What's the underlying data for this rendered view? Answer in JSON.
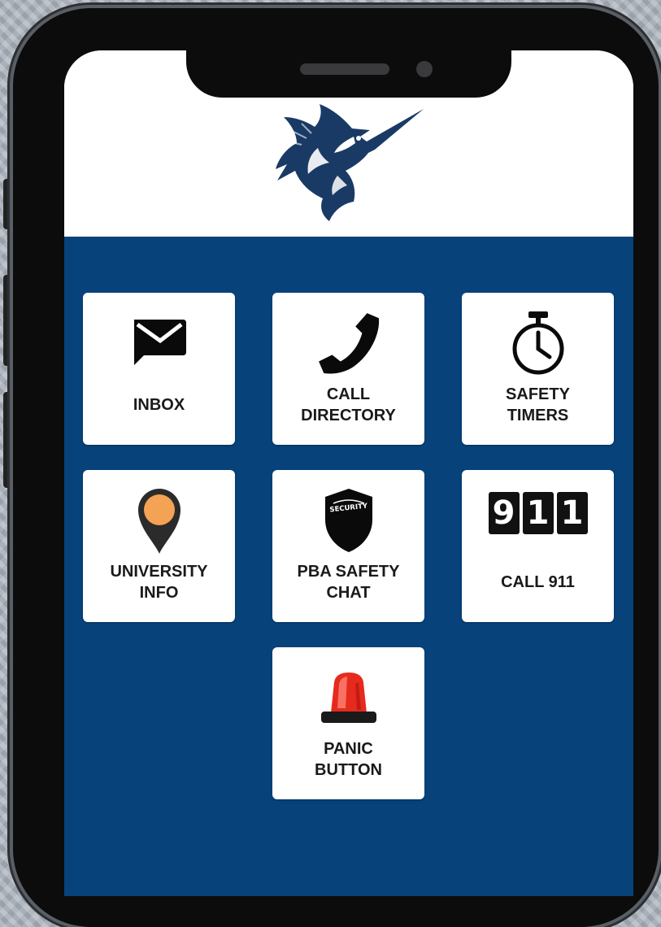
{
  "tiles": [
    {
      "id": "inbox",
      "label": "INBOX",
      "icon": "envelope-icon"
    },
    {
      "id": "call-directory",
      "label": "CALL\nDIRECTORY",
      "icon": "phone-icon"
    },
    {
      "id": "safety-timers",
      "label": "SAFETY\nTIMERS",
      "icon": "stopwatch-icon"
    },
    {
      "id": "university-info",
      "label": "UNIVERSITY\nINFO",
      "icon": "map-pin-icon"
    },
    {
      "id": "pba-safety-chat",
      "label": "PBA SAFETY\nCHAT",
      "icon": "security-shield-icon",
      "icon_text": "SECURITY"
    },
    {
      "id": "call-911",
      "label": "CALL 911",
      "icon": "911-digits-icon",
      "digits": [
        "9",
        "1",
        "1"
      ]
    },
    {
      "id": "panic-button",
      "label": "PANIC\nBUTTON",
      "icon": "siren-icon"
    }
  ],
  "logo": {
    "icon": "marlin-logo"
  },
  "colors": {
    "brand_blue": "#07427b",
    "tile_bg": "#ffffff",
    "pin_orange": "#f4a253",
    "siren_red": "#e62a1e"
  }
}
